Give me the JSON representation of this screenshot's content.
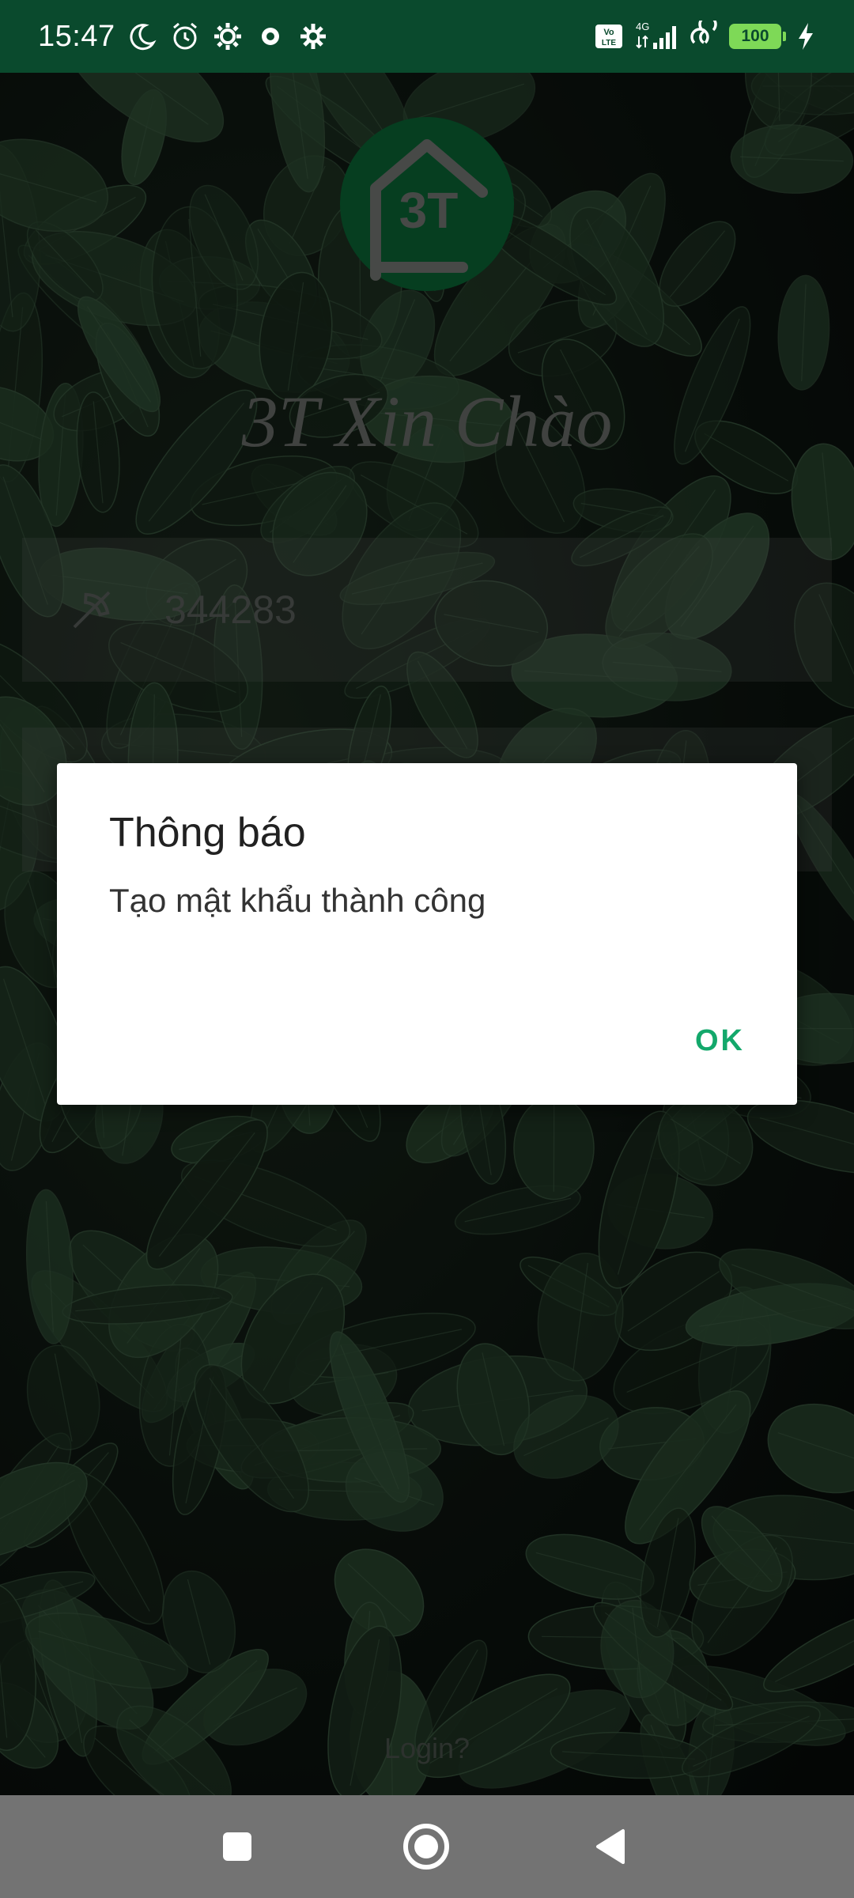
{
  "status_bar": {
    "time": "15:47",
    "network": "4G",
    "volte": "Vo LTE",
    "battery": "100",
    "icons_left": [
      "moon-icon",
      "alarm-icon",
      "gear-icon",
      "app-icon",
      "gear-icon"
    ],
    "icons_right": [
      "volte-icon",
      "signal-icon",
      "link-icon",
      "battery-icon",
      "charging-icon"
    ]
  },
  "login": {
    "logo_text": "3T",
    "greeting": "3T Xin Chào",
    "code_value": "344283",
    "code_icon": "phone-disabled-icon",
    "login_link": "Login?"
  },
  "dialog": {
    "title": "Thông báo",
    "message": "Tạo mật khẩu thành công",
    "ok_label": "OK"
  },
  "colors": {
    "status_bar": "#0a4a2d",
    "logo": "#0b6b37",
    "accent": "#13a86b",
    "nav_bar": "#737373"
  },
  "nav": {
    "recent": "recent-apps-icon",
    "home": "home-icon",
    "back": "back-icon"
  }
}
